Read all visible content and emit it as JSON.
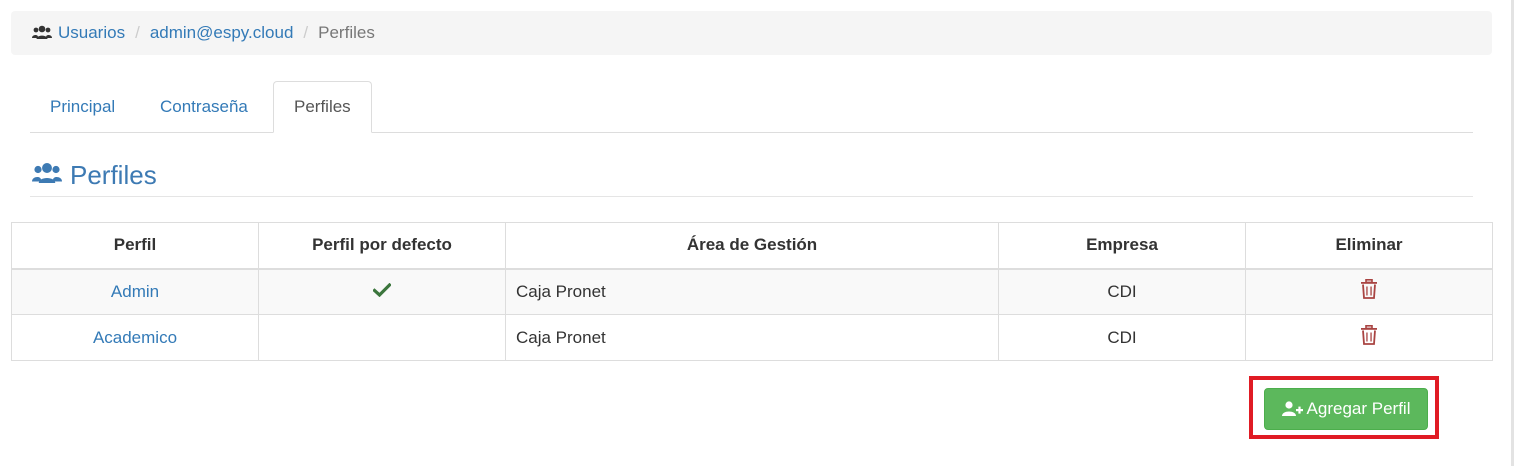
{
  "breadcrumb": {
    "icon": "users-icon",
    "items": [
      "Usuarios",
      "admin@espy.cloud"
    ],
    "separator": "/",
    "current": "Perfiles"
  },
  "tabs": [
    {
      "label": "Principal",
      "active": false
    },
    {
      "label": "Contraseña",
      "active": false
    },
    {
      "label": "Perfiles",
      "active": true
    }
  ],
  "section": {
    "icon": "users-icon",
    "title": "Perfiles"
  },
  "table": {
    "headers": [
      "Perfil",
      "Perfil por defecto",
      "Área de Gestión",
      "Empresa",
      "Eliminar"
    ],
    "rows": [
      {
        "perfil": "Admin",
        "default_icon": "check-icon",
        "area": "Caja Pronet",
        "empresa": "CDI",
        "delete_icon": "trash-icon"
      },
      {
        "perfil": "Academico",
        "default_icon": "",
        "area": "Caja Pronet",
        "empresa": "CDI",
        "delete_icon": "trash-icon"
      }
    ]
  },
  "add_button": {
    "label": "Agregar Perfil",
    "icon": "user-plus-icon"
  },
  "colors": {
    "link": "#337ab7",
    "success": "#5cb85c",
    "danger": "#a94442",
    "check": "#3c763d",
    "highlight": "#e01b24"
  }
}
